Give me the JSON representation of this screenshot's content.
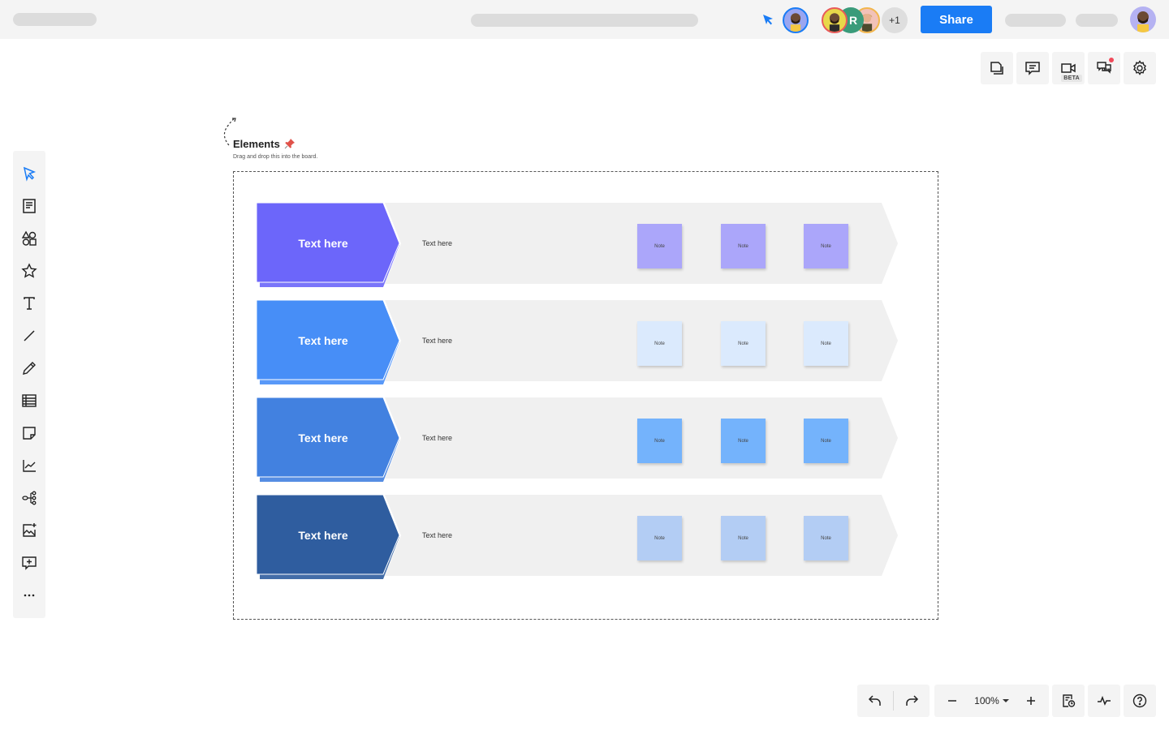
{
  "topbar": {
    "share_label": "Share",
    "collaborator_initial": "R",
    "more_collaborators": "+1"
  },
  "right_tools": [
    {
      "name": "pages",
      "icon": "pages-icon"
    },
    {
      "name": "comments",
      "icon": "comment-icon"
    },
    {
      "name": "video",
      "icon": "video-icon",
      "badge": "BETA"
    },
    {
      "name": "chat",
      "icon": "chat-icon",
      "notification": true
    },
    {
      "name": "settings",
      "icon": "gear-icon"
    }
  ],
  "left_tools": [
    {
      "name": "select",
      "icon": "cursor-icon",
      "active": true
    },
    {
      "name": "templates",
      "icon": "template-icon"
    },
    {
      "name": "shapes",
      "icon": "shapes-icon"
    },
    {
      "name": "icons",
      "icon": "star-icon"
    },
    {
      "name": "text",
      "icon": "text-icon"
    },
    {
      "name": "line",
      "icon": "line-icon"
    },
    {
      "name": "pen",
      "icon": "pencil-icon"
    },
    {
      "name": "table",
      "icon": "table-icon"
    },
    {
      "name": "sticky-note",
      "icon": "sticky-note-icon"
    },
    {
      "name": "chart",
      "icon": "chart-icon"
    },
    {
      "name": "mind-map",
      "icon": "mindmap-icon"
    },
    {
      "name": "image",
      "icon": "image-add-icon"
    },
    {
      "name": "add-comment",
      "icon": "comment-add-icon"
    },
    {
      "name": "more",
      "icon": "more-icon"
    }
  ],
  "elements": {
    "title": "Elements",
    "subtitle": "Drag and drop this into the board."
  },
  "rows": [
    {
      "title": "Text here",
      "text": "Text here",
      "color": "#6c66fa",
      "note_color": "#aba6fa",
      "notes": [
        "Note",
        "Note",
        "Note"
      ]
    },
    {
      "title": "Text here",
      "text": "Text here",
      "color": "#478ef7",
      "note_color": "#dbeafd",
      "notes": [
        "Note",
        "Note",
        "Note"
      ]
    },
    {
      "title": "Text here",
      "text": "Text here",
      "color": "#4281e0",
      "note_color": "#74b3fc",
      "notes": [
        "Note",
        "Note",
        "Note"
      ]
    },
    {
      "title": "Text here",
      "text": "Text here",
      "color": "#2f5d9f",
      "note_color": "#b3cdf4",
      "notes": [
        "Note",
        "Note",
        "Note"
      ]
    }
  ],
  "bottom": {
    "zoom_level": "100%"
  },
  "colors": {
    "accent": "#1a7cf5",
    "toolbar_bg": "#f4f4f4",
    "lane_bg": "#f0f0f0"
  }
}
